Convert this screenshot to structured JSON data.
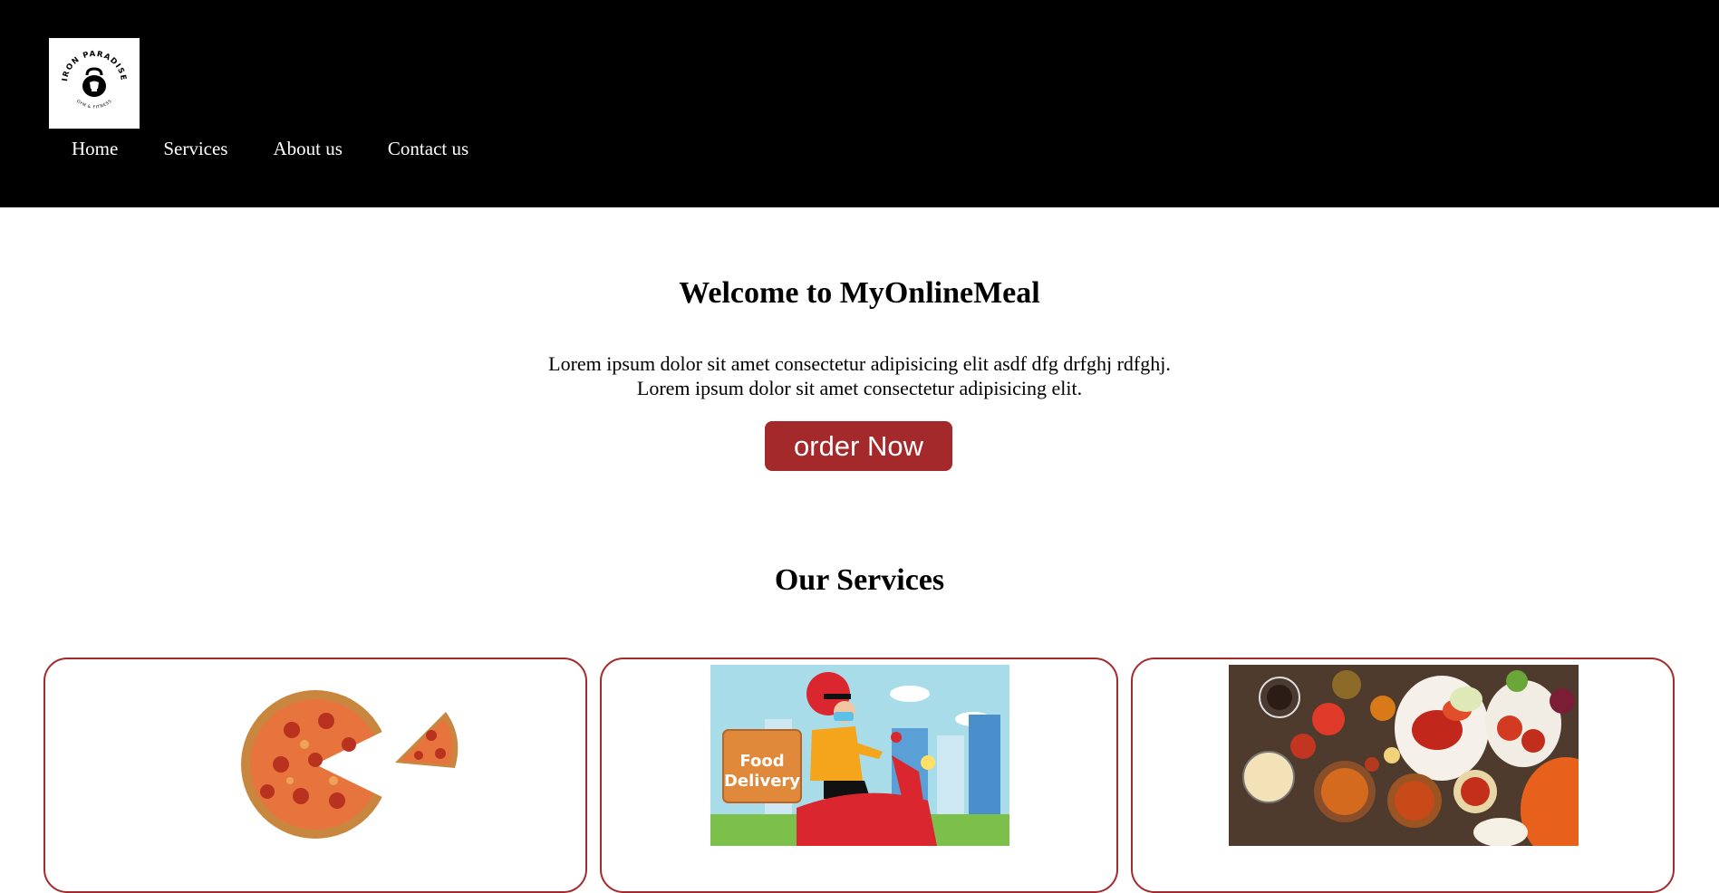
{
  "brand": {
    "logo_text_top": "IRON PARADISE",
    "logo_text_bottom": "GYM & FITNESS"
  },
  "nav": {
    "items": [
      {
        "label": "Home"
      },
      {
        "label": "Services"
      },
      {
        "label": "About us"
      },
      {
        "label": "Contact us"
      }
    ]
  },
  "hero": {
    "title": "Welcome to MyOnlineMeal",
    "line1": "Lorem ipsum dolor sit amet consectetur adipisicing elit asdf dfg drfghj rdfghj.",
    "line2": "Lorem ipsum dolor sit amet consectetur adipisicing elit.",
    "button_label": "order Now"
  },
  "services": {
    "title": "Our Services",
    "cards": [
      {
        "image": "pizza-image"
      },
      {
        "image": "food-delivery-image",
        "image_text": "Food Delivery"
      },
      {
        "image": "indian-food-spread-image"
      }
    ]
  },
  "colors": {
    "header_bg": "#000000",
    "accent": "#a4292b",
    "text": "#000000"
  }
}
